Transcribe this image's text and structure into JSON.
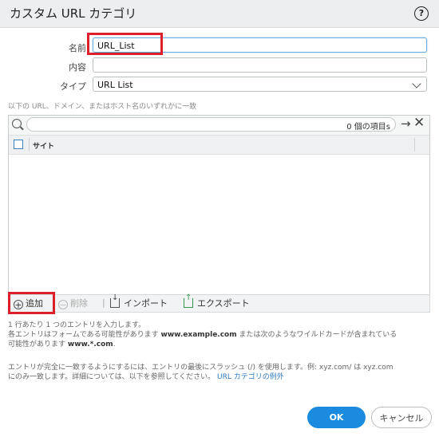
{
  "dialog": {
    "title": "カスタム URL カテゴリ",
    "help_icon": "?"
  },
  "form": {
    "name_label": "名前",
    "name_value": "URL_List",
    "description_label": "内容",
    "description_value": "",
    "type_label": "タイプ",
    "type_value": "URL List"
  },
  "section_label": "以下の URL、ドメイン、またはホスト名のいずれかに一致",
  "table": {
    "search_value": "",
    "count_text": "0 個の項目s",
    "apply_icon": "→",
    "clear_icon": "✕",
    "column_header": "サイト",
    "rows": []
  },
  "toolbar": {
    "add_label": "追加",
    "delete_label": "削除",
    "separator": "|",
    "import_label": "インポート",
    "export_label": "エクスポート"
  },
  "hints": {
    "line1": "1 行あたり 1 つのエントリを入力します。",
    "line2a": "各エントリはフォームである可能性があります ",
    "line2b": "www.example.com",
    "line2c": " または次のようなワイルドカードが含まれている",
    "line3a": "可能性があります ",
    "line3b": "www.*.com",
    "line3c": ".",
    "line4": "エントリが完全に一致するようにするには、エントリの最後にスラッシュ (/) を使用します。例: xyz.com/ は xyz.com",
    "line5": "にのみ一致します。詳細については、以下を参照してください。",
    "link": "URL カテゴリの例外"
  },
  "buttons": {
    "ok_label": "OK",
    "cancel_label": "キャンセル"
  },
  "colors": {
    "accent": "#1b8be0",
    "highlight": "#dc1f2b",
    "link": "#2f7bc2"
  }
}
